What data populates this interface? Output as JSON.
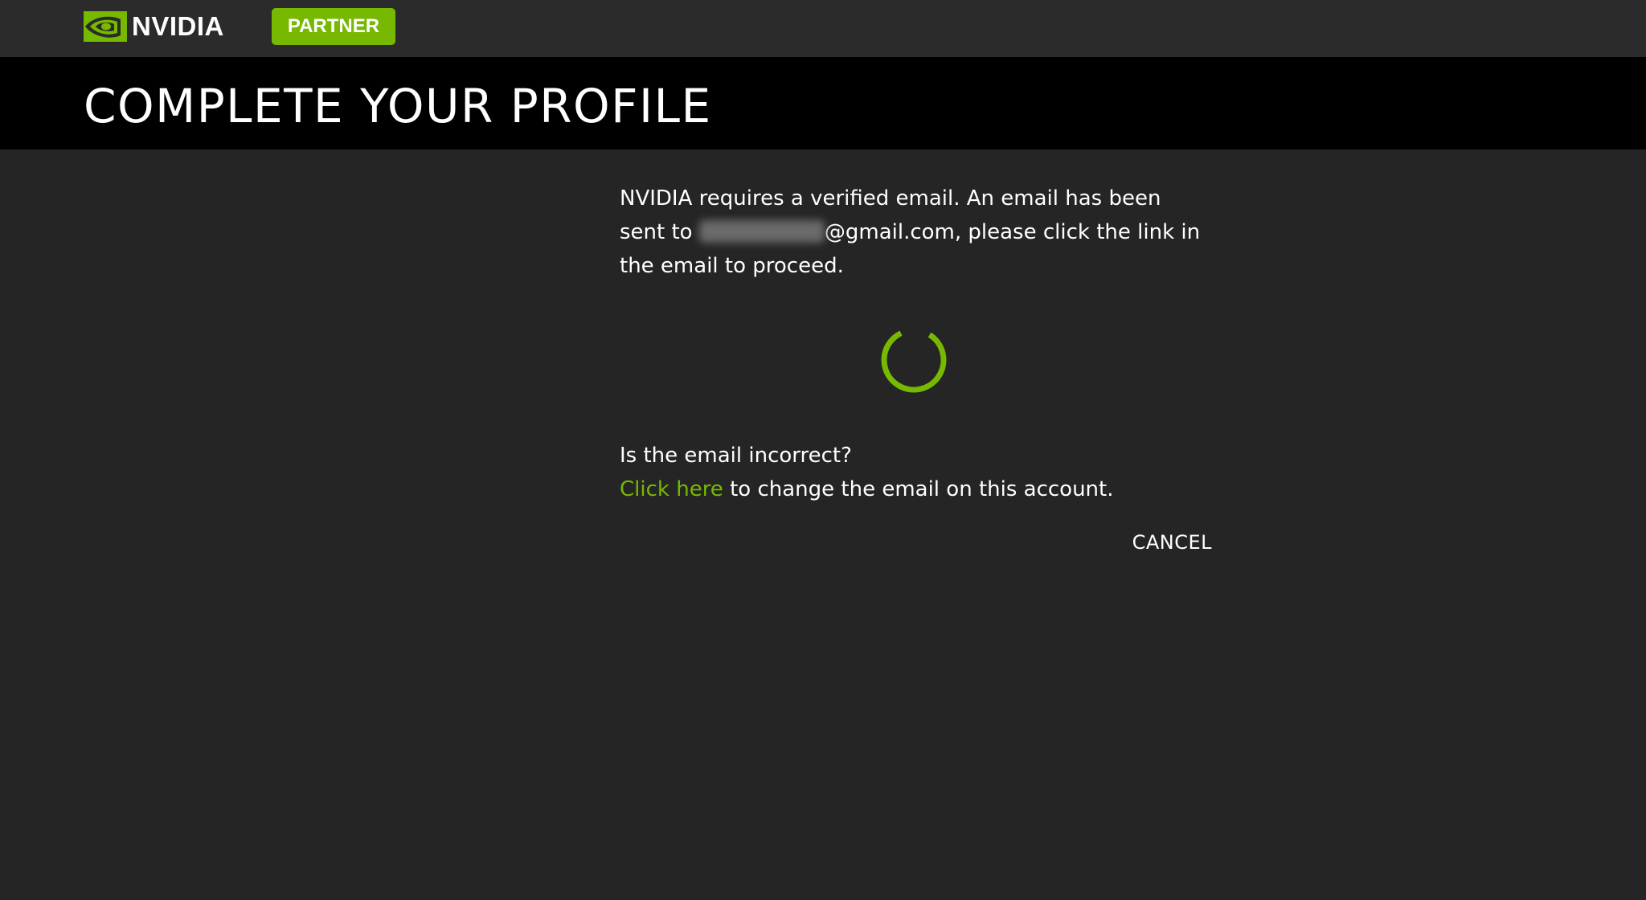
{
  "brand": {
    "logo_text": "NVIDIA",
    "badge_label": "PARTNER",
    "accent_color": "#76b900"
  },
  "header": {
    "title": "COMPLETE YOUR PROFILE"
  },
  "verify": {
    "message_part1": "NVIDIA requires a verified email. An email has been sent to",
    "email_domain": "@gmail.com",
    "message_part2": ", please click the link in the email to proceed.",
    "spinner_icon": "loading-spinner-icon"
  },
  "incorrect": {
    "question": "Is the email incorrect?",
    "link_label": "Click here",
    "link_suffix": " to change the email on this account."
  },
  "actions": {
    "cancel_label": "CANCEL"
  }
}
